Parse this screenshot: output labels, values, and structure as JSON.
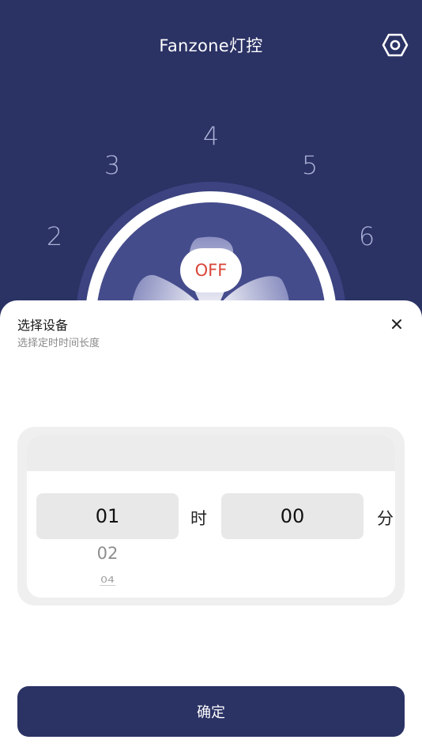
{
  "header": {
    "title": "Fanzone灯控",
    "settings_icon": "settings-hex-icon"
  },
  "dial": {
    "speed_levels": [
      "2",
      "3",
      "4",
      "5",
      "6"
    ],
    "power_label": "OFF",
    "fan_icon": "fan-icon"
  },
  "sheet": {
    "title": "选择设备",
    "subtitle": "选择定时时间长度",
    "close_icon": "close-icon",
    "picker": {
      "hours_selected": "01",
      "hour_unit": "时",
      "minutes_selected": "00",
      "minute_unit": "分",
      "hours_next": "02",
      "hours_after": "04"
    },
    "confirm_label": "确定"
  },
  "colors": {
    "primary": "#2b3264",
    "dial_face": "#454c8c",
    "power_text": "#d9463a"
  }
}
